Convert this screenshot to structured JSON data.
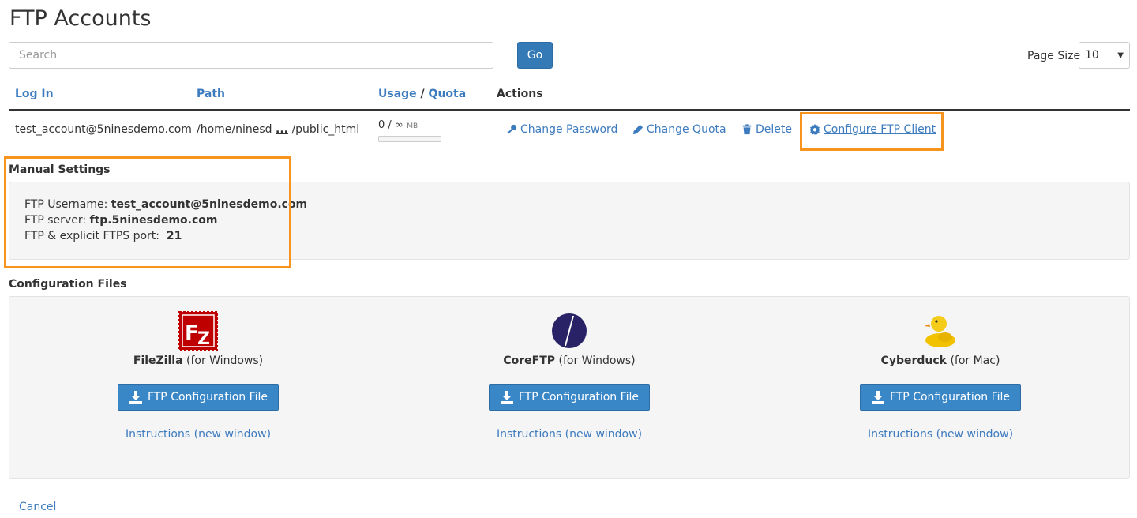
{
  "page": {
    "title": "FTP Accounts"
  },
  "search": {
    "placeholder": "Search",
    "value": "",
    "go_label": "Go"
  },
  "page_size": {
    "label": "Page Size",
    "value": "10"
  },
  "table": {
    "headers": {
      "login": "Log In",
      "path": "Path",
      "usage": "Usage",
      "usage_sep": "/",
      "quota": "Quota",
      "actions": "Actions"
    },
    "row": {
      "login": "test_account@5ninesdemo.com",
      "path_start": "/home/ninesd",
      "path_ellipsis": "...",
      "path_end": "/public_html",
      "usage": "0 / ∞",
      "usage_unit": "MB"
    },
    "actions": {
      "change_password": "Change Password",
      "change_quota": "Change Quota",
      "delete": "Delete",
      "configure": "Configure FTP Client"
    }
  },
  "manual": {
    "heading": "Manual Settings",
    "username_label": "FTP Username:",
    "username_value": "test_account@5ninesdemo.com",
    "server_label": "FTP server:",
    "server_value": "ftp.5ninesdemo.com",
    "port_label": "FTP & explicit FTPS port:",
    "port_value": "21"
  },
  "config": {
    "heading": "Configuration Files",
    "clients": [
      {
        "name": "FileZilla",
        "platform": "(for Windows)",
        "button": "FTP Configuration File",
        "instructions": "Instructions (new window)",
        "icon": "filezilla-logo"
      },
      {
        "name": "CoreFTP",
        "platform": "(for Windows)",
        "button": "FTP Configuration File",
        "instructions": "Instructions (new window)",
        "icon": "coreftp-logo"
      },
      {
        "name": "Cyberduck",
        "platform": "(for Mac)",
        "button": "FTP Configuration File",
        "instructions": "Instructions (new window)",
        "icon": "cyberduck-logo"
      }
    ]
  },
  "cancel_label": "Cancel",
  "colors": {
    "link": "#3d7bbf",
    "button": "#337ab7",
    "highlight": "#f7941d",
    "panel": "#f5f5f5"
  }
}
